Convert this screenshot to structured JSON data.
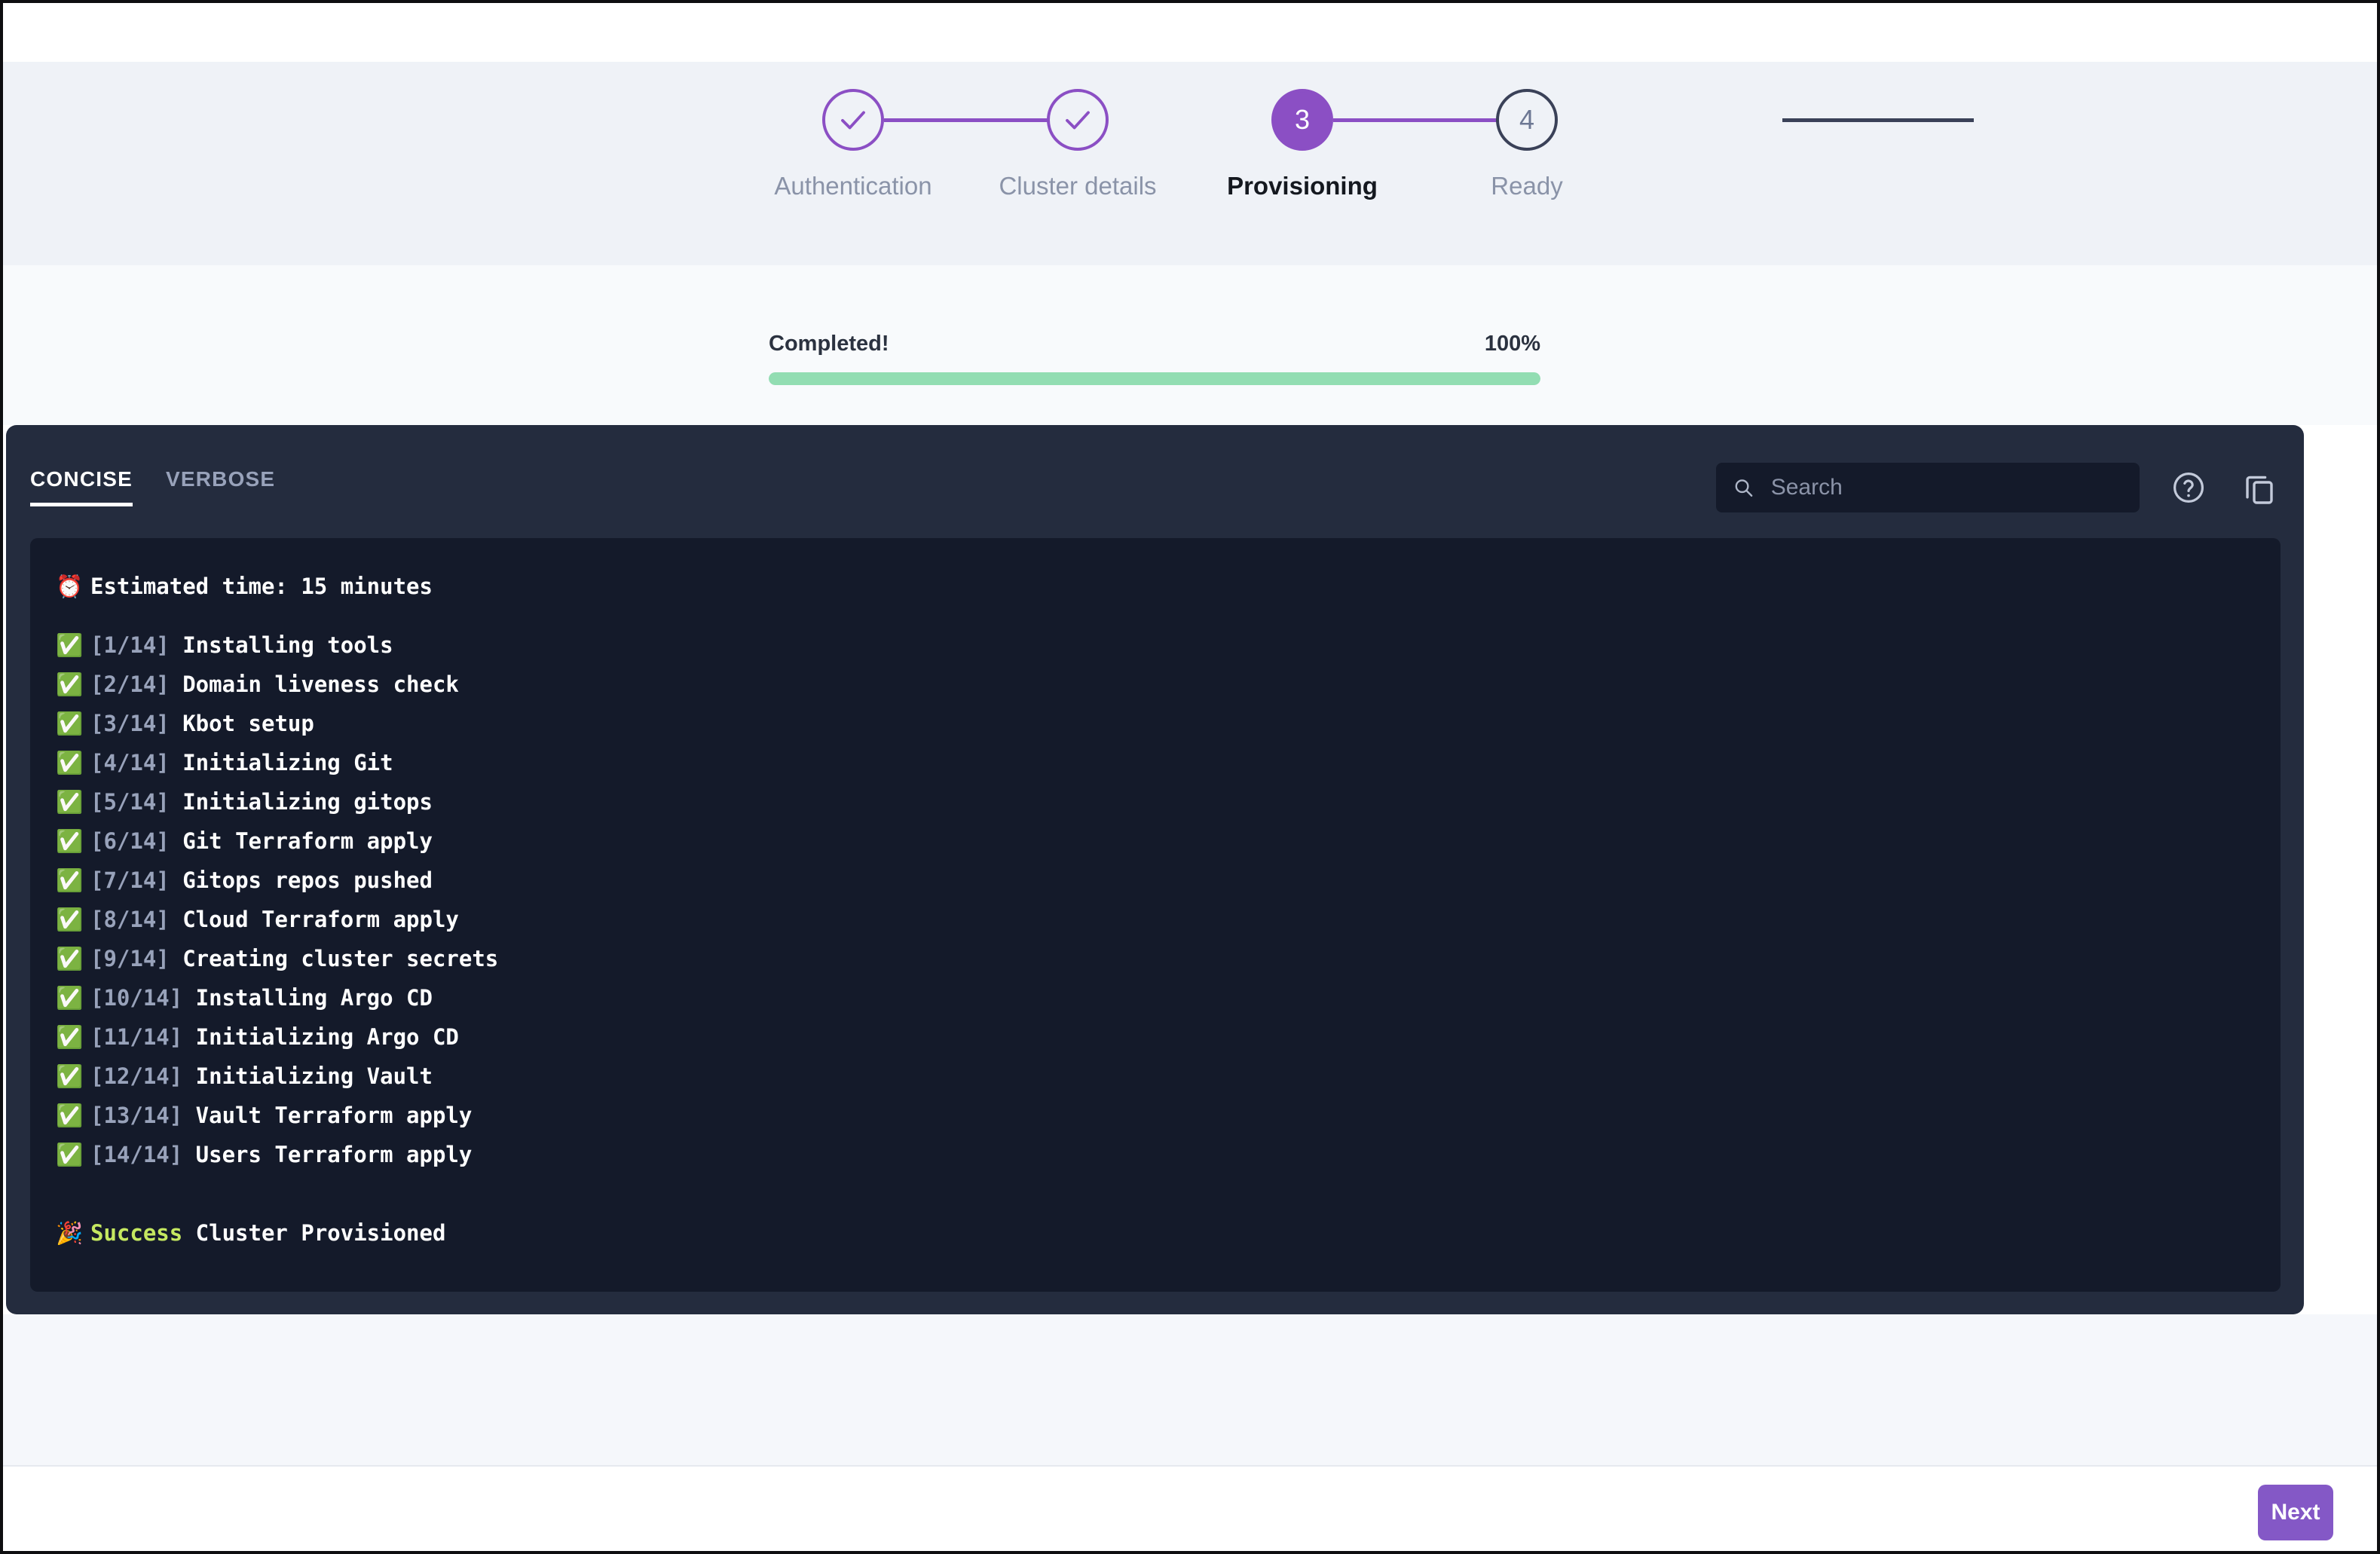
{
  "stepper": {
    "steps": [
      {
        "index": "1",
        "label": "Authentication",
        "state": "done"
      },
      {
        "index": "2",
        "label": "Cluster details",
        "state": "done"
      },
      {
        "index": "3",
        "label": "Provisioning",
        "state": "current"
      },
      {
        "index": "4",
        "label": "Ready",
        "state": "todo"
      }
    ]
  },
  "progress": {
    "status_label": "Completed!",
    "percent_label": "100%",
    "percent_value": 100,
    "fill_color": "#92ddb2"
  },
  "console": {
    "tabs": [
      {
        "label": "CONCISE",
        "active": true
      },
      {
        "label": "VERBOSE",
        "active": false
      }
    ],
    "search": {
      "placeholder": "Search",
      "value": ""
    },
    "icons": {
      "help": "help-circle-icon",
      "copy": "copy-icon"
    },
    "log": {
      "estimate_emoji": "⏰",
      "estimate_text": "Estimated time: 15 minutes",
      "steps": [
        {
          "counter": "[1/14]",
          "text": "Installing tools"
        },
        {
          "counter": "[2/14]",
          "text": "Domain liveness check"
        },
        {
          "counter": "[3/14]",
          "text": "Kbot setup"
        },
        {
          "counter": "[4/14]",
          "text": "Initializing Git"
        },
        {
          "counter": "[5/14]",
          "text": "Initializing gitops"
        },
        {
          "counter": "[6/14]",
          "text": "Git Terraform apply"
        },
        {
          "counter": "[7/14]",
          "text": "Gitops repos pushed"
        },
        {
          "counter": "[8/14]",
          "text": "Cloud Terraform apply"
        },
        {
          "counter": "[9/14]",
          "text": "Creating cluster secrets"
        },
        {
          "counter": "[10/14]",
          "text": "Installing Argo CD"
        },
        {
          "counter": "[11/14]",
          "text": "Initializing Argo CD"
        },
        {
          "counter": "[12/14]",
          "text": "Initializing Vault"
        },
        {
          "counter": "[13/14]",
          "text": "Vault Terraform apply"
        },
        {
          "counter": "[14/14]",
          "text": "Users Terraform apply"
        }
      ],
      "check_emoji": "✅",
      "success_emoji": "🎉",
      "success_word": "Success",
      "success_text": "Cluster Provisioned"
    }
  },
  "footer": {
    "next_label": "Next"
  },
  "colors": {
    "accent_purple": "#8b4fc4",
    "button_purple": "#8458c6",
    "progress_green": "#92ddb2",
    "success_green": "#c5e860",
    "panel_dark": "#242c3e",
    "log_dark": "#141a2a"
  }
}
